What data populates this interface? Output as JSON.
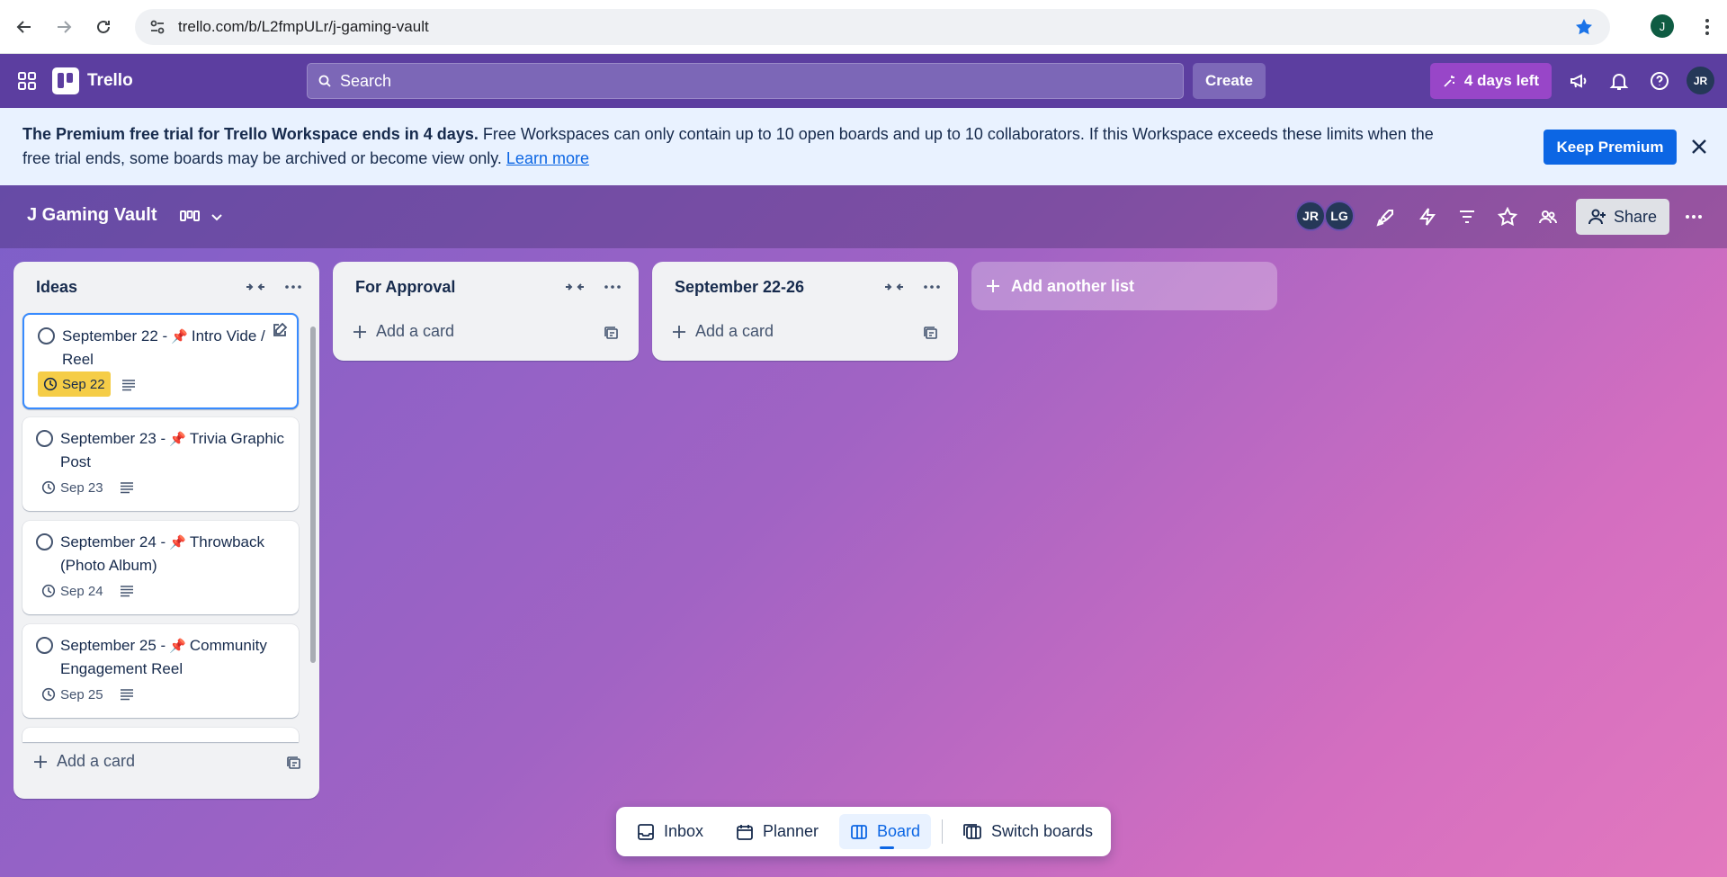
{
  "browser": {
    "url": "trello.com/b/L2fmpULr/j-gaming-vault",
    "profile_initial": "J"
  },
  "header": {
    "app_name": "Trello",
    "search_placeholder": "Search",
    "create_label": "Create",
    "trial_label": "4 days left",
    "avatar_initials": "JR"
  },
  "banner": {
    "bold_text": "The Premium free trial for Trello Workspace ends in 4 days.",
    "body_text": " Free Workspaces can only contain up to 10 open boards and up to 10 collaborators. If this Workspace exceeds these limits when the free trial ends, some boards may be archived or become view only. ",
    "link_text": "Learn more",
    "keep_label": "Keep Premium"
  },
  "board": {
    "title": "J Gaming Vault",
    "members": [
      "JR",
      "LG"
    ],
    "share_label": "Share",
    "add_list_label": "Add another list"
  },
  "lists": [
    {
      "title": "Ideas",
      "add_card_label": "Add a card",
      "cards": [
        {
          "title_a": "September 22 -",
          "title_b": "Intro Vide / Reel",
          "pin": "📌",
          "due": "Sep 22"
        },
        {
          "title_a": "September 23 -",
          "title_b": "Trivia Graphic Post",
          "pin": "📌",
          "due": "Sep 23"
        },
        {
          "title_a": "September 24 -",
          "title_b": "Throwback (Photo Album)",
          "pin": "📌",
          "due": "Sep 24"
        },
        {
          "title_a": "September 25 -",
          "title_b": "Community Engagement Reel",
          "pin": "📌",
          "due": "Sep 25"
        }
      ]
    },
    {
      "title": "For Approval",
      "add_card_label": "Add a card"
    },
    {
      "title": "September 22-26",
      "add_card_label": "Add a card"
    }
  ],
  "bottom_nav": {
    "inbox": "Inbox",
    "planner": "Planner",
    "board": "Board",
    "switch": "Switch boards"
  },
  "colors": {
    "header": "#5c3ea0",
    "banner": "#e9f2ff",
    "primary": "#0c66e4",
    "due_soon": "#f5cd47",
    "pin": "#e2384d"
  }
}
